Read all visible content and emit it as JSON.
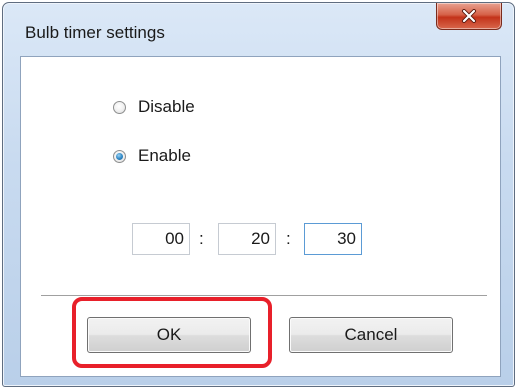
{
  "window": {
    "title": "Bulb timer settings",
    "close_icon": "close-icon",
    "close_color": "#c94a30"
  },
  "options": {
    "disable_label": "Disable",
    "enable_label": "Enable",
    "selected": "Enable"
  },
  "timer": {
    "hours": "00",
    "minutes": "20",
    "seconds": "30",
    "separator": ":"
  },
  "buttons": {
    "ok_label": "OK",
    "cancel_label": "Cancel"
  },
  "annotation": {
    "highlight_color": "#e8202a",
    "highlighted": "OK"
  }
}
